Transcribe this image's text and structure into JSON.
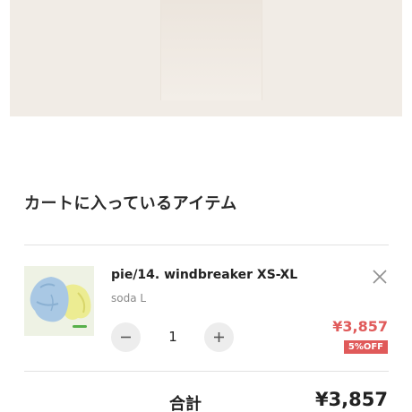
{
  "banner": {
    "image": "product-photo-banner"
  },
  "cart": {
    "title": "カートに入っているアイテム",
    "items": [
      {
        "image": "windbreaker-product-thumbnail",
        "name": "pie/14. windbreaker XS-XL",
        "variant": "soda L",
        "quantity": "1",
        "price": "¥3,857",
        "discount": "5%OFF"
      }
    ]
  },
  "summary": {
    "total_label": "合計",
    "total_amount": "¥3,857"
  },
  "icons": {
    "remove": "close-icon",
    "decrease": "minus-icon",
    "increase": "plus-icon"
  },
  "colors": {
    "accent": "#e05a5a",
    "banner_bg": "#f1ece6",
    "divider": "#e2e2e2",
    "qty_button": "#ededed"
  }
}
